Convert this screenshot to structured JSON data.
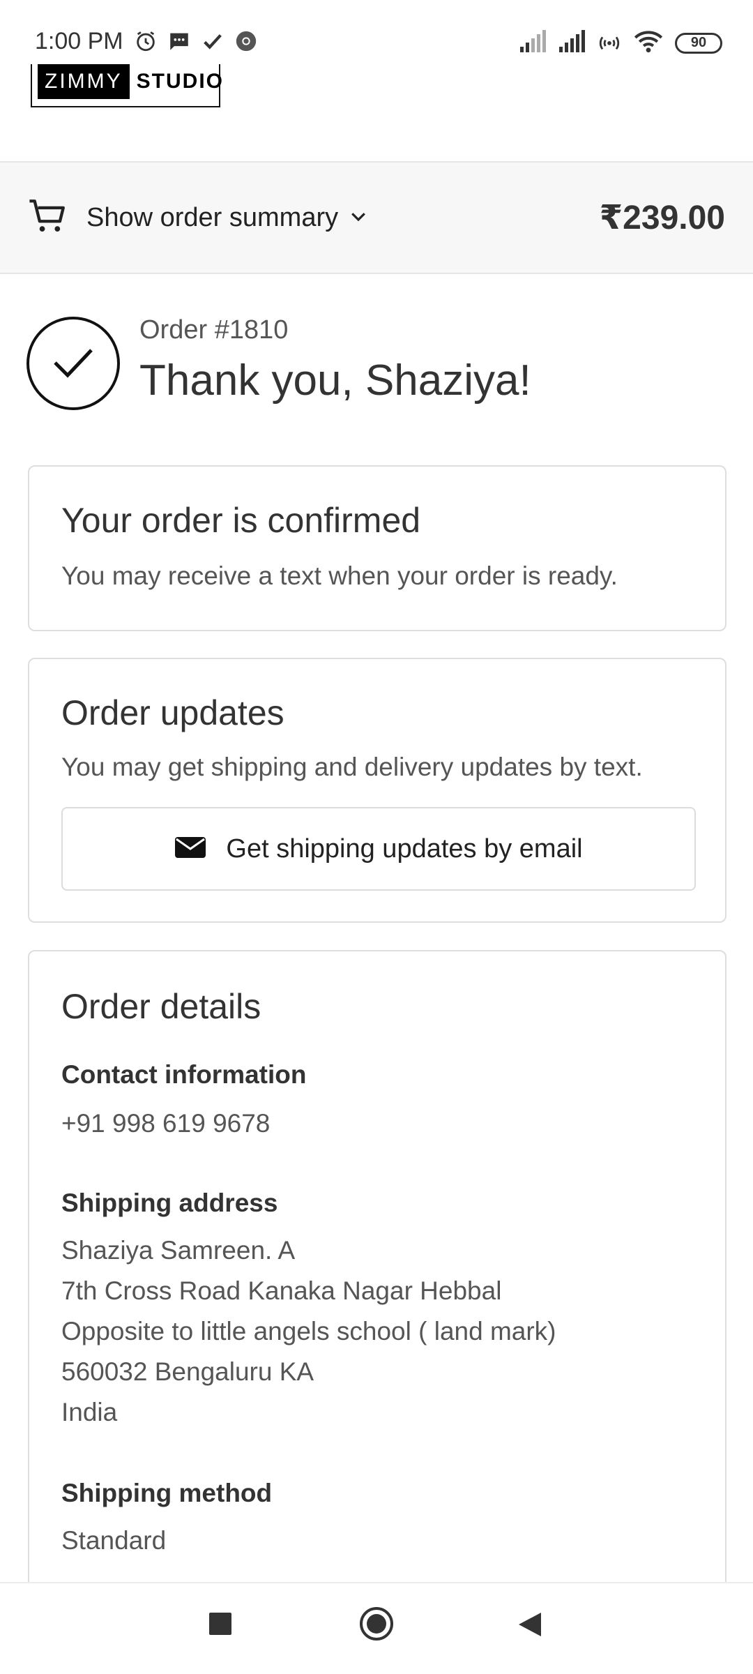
{
  "status_bar": {
    "time": "1:00 PM",
    "battery": "90",
    "left_icons": [
      "alarm-icon",
      "message-icon",
      "check-icon",
      "chrome-icon"
    ],
    "right_icons": [
      "signal-weak-icon",
      "signal-icon",
      "hotspot-icon",
      "wifi-icon",
      "battery-icon"
    ]
  },
  "logo": {
    "part1": "ZIMMY",
    "part2": "STUDIO"
  },
  "summary": {
    "label": "Show order summary",
    "price": "₹239.00"
  },
  "confirmation": {
    "order_number": "Order #1810",
    "thank_you": "Thank you, Shaziya!"
  },
  "confirmed_card": {
    "title": "Your order is confirmed",
    "text": "You may receive a text when your order is ready."
  },
  "updates_card": {
    "title": "Order updates",
    "text": "You may get shipping and delivery updates by text.",
    "button_label": "Get shipping updates by email"
  },
  "details_card": {
    "title": "Order details",
    "contact_heading": "Contact information",
    "contact_value": "+91 998 619 9678",
    "shipping_heading": "Shipping address",
    "address_lines": [
      "Shaziya Samreen. A",
      "7th Cross Road Kanaka Nagar Hebbal",
      "Opposite to little angels school ( land mark)",
      "560032 Bengaluru KA",
      "India"
    ],
    "method_heading": "Shipping method",
    "method_value": "Standard"
  },
  "nav": {
    "buttons": [
      "recents-button",
      "home-button",
      "back-button"
    ]
  },
  "colors": {
    "accent": "#111111",
    "summary_bg": "#f7f7f7",
    "border": "#dedede"
  }
}
